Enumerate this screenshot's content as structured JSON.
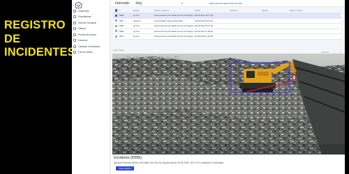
{
  "promo": {
    "title_lines": [
      "REGISTRO",
      "DE",
      "INCIDENTES"
    ]
  },
  "sidebar": {
    "items": [
      {
        "label": "Incidentes",
        "icon": "incidents-icon"
      },
      {
        "label": "Estadísticas",
        "icon": "chart-icon"
      },
      {
        "label": "Informe Semanal",
        "icon": "report-icon"
      },
      {
        "label": "Galería",
        "icon": "gallery-icon"
      },
      {
        "label": "Puntos de Acción",
        "icon": "action-points-icon"
      },
      {
        "label": "Usuarios",
        "icon": "users-icon"
      },
      {
        "label": "Cambiar Contraseña",
        "icon": "key-icon"
      },
      {
        "label": "Cerrar Sesión",
        "icon": "logout-icon"
      }
    ]
  },
  "header": {
    "interval_label": "Intervalo:",
    "interval_value": "Hoy",
    "link_text": "DESCARGAR REPORTE EN PDF"
  },
  "table": {
    "columns": [
      "#",
      "Equipo",
      "Fecha / Incidente",
      "Fecha",
      "Incidente",
      "Estado",
      "Editar / Cargar"
    ],
    "rows": [
      {
        "id": "5995",
        "equipo": "pp-tool",
        "desc": "Persona Dentro De Radio De Giro De Equipo",
        "fecha": "26-03-2022 18:17:30",
        "selected": true
      },
      {
        "id": "5987",
        "equipo": "pala-tool",
        "desc": "Persona Bajo Carga Suspendida",
        "fecha": "26-03-2022 18:11:46",
        "selected": false
      },
      {
        "id": "5980",
        "equipo": "pp-tool",
        "desc": "Persona Dentro De Radio De Giro De Equipo",
        "fecha": "26-03-2022 18:07:55",
        "selected": false
      },
      {
        "id": "5966",
        "equipo": "pp-tool",
        "desc": "Persona Dentro De Radio De Giro De Equipo",
        "fecha": "26-03-2022 17:58:20",
        "selected": false
      },
      {
        "id": "5951",
        "equipo": "pp-tool",
        "desc": "Persona Dentro De Radio De Giro De Equipo",
        "fecha": "26-03-2022 17:46:09",
        "selected": false
      }
    ],
    "pager_left": "1 de 1 result",
    "pager_right": "1-5 of 12",
    "prev": "‹",
    "next": "›"
  },
  "video": {
    "timestamp": "26-03-2022 18:21:05"
  },
  "footer": {
    "title": "Incidente [5995]",
    "description": "ppt-tool Persona Dentro De Radio De Giro De Equipo Mod4 26-03-2022 18:17:30 | Incidente Confirmado",
    "button": "Fotos relación"
  },
  "colors": {
    "accent": "#2d4fd1",
    "promo_text": "#f5e21b",
    "excavator": "#e3a21c",
    "detection_box": "#4b3fd8"
  }
}
